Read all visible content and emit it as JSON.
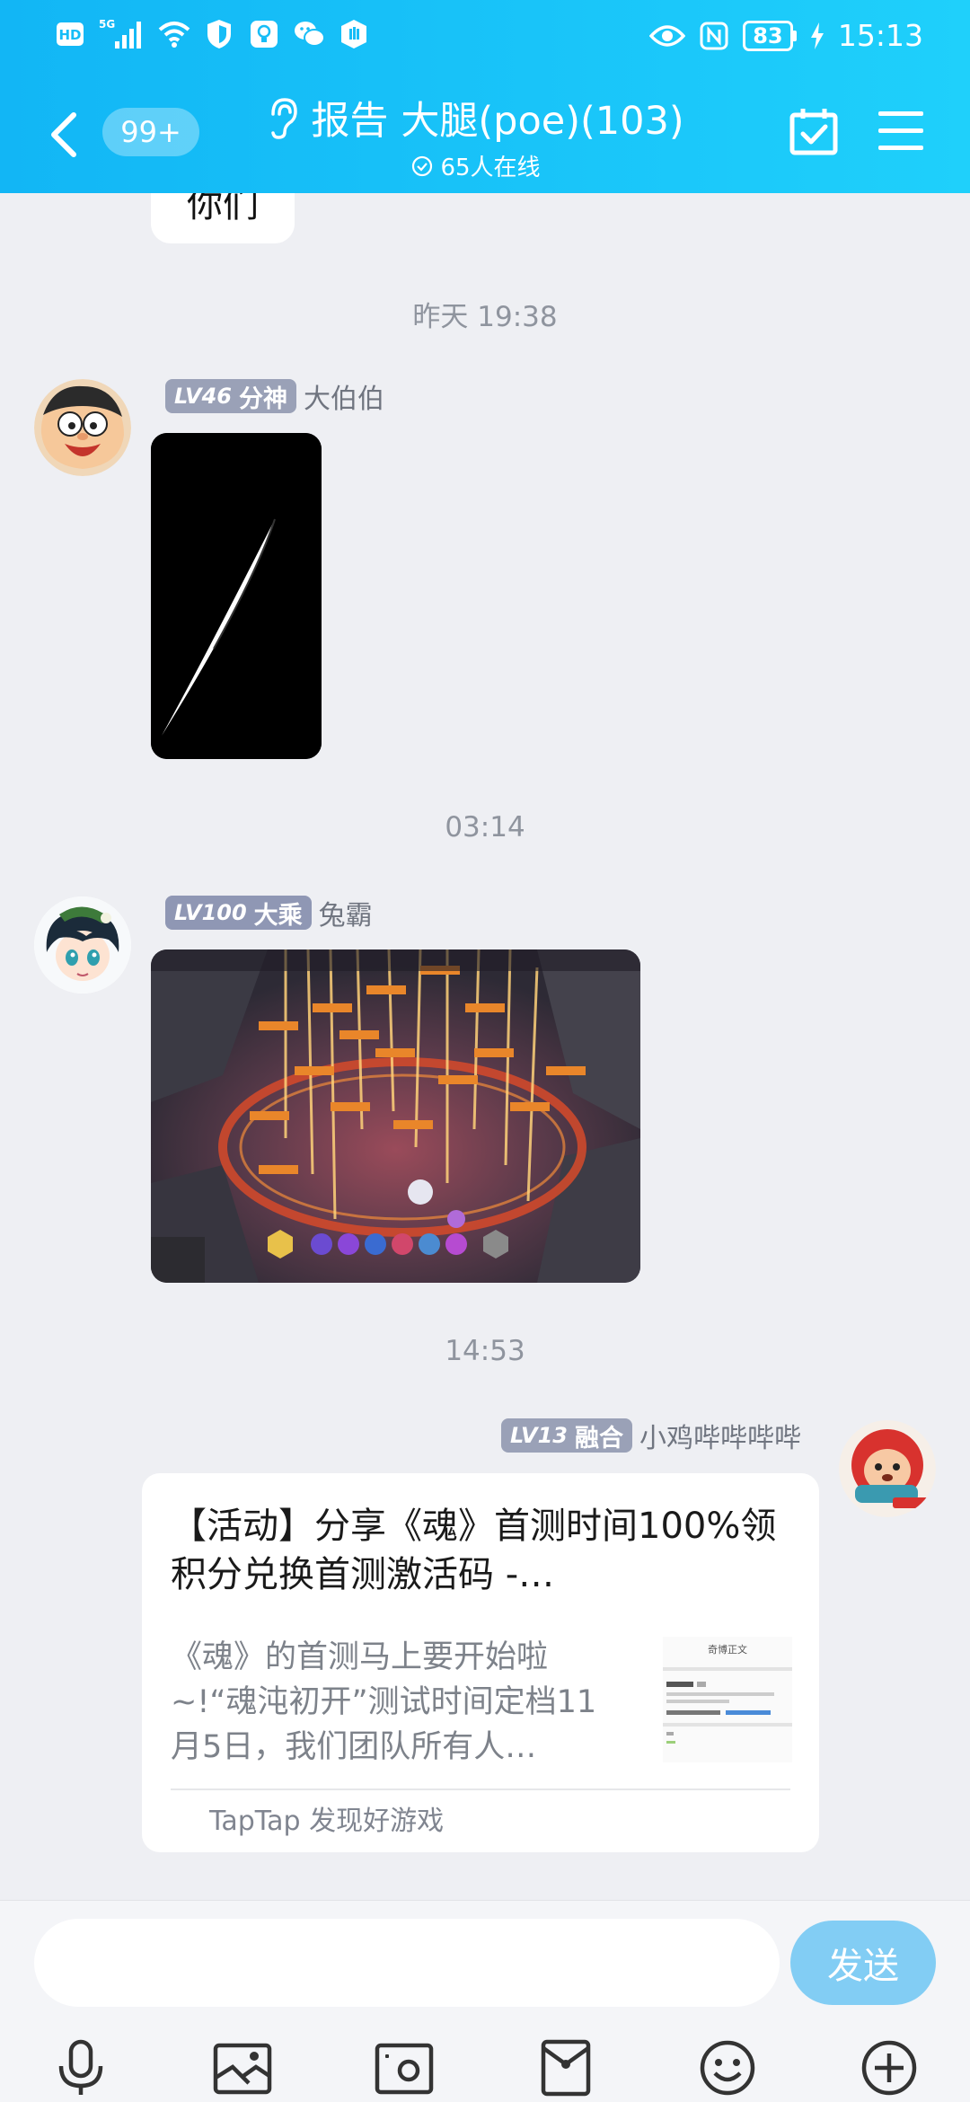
{
  "status_bar": {
    "hd": "HD",
    "network": "5G",
    "battery": "83",
    "time": "15:13"
  },
  "header": {
    "unread_badge": "99+",
    "title_tag": "报告",
    "title_name": "大腿(poe)(103)",
    "online": "65人在线"
  },
  "partial_message": {
    "text": "你们"
  },
  "messages": [
    {
      "timestamp": "昨天 19:38",
      "level": "LV46",
      "rank": "分神",
      "rank_color": "#9aa1b7",
      "nickname": "大伯伯",
      "content": "image"
    },
    {
      "timestamp": "03:14",
      "level": "LV100",
      "rank": "大乘",
      "rank_color": "#8f97b4",
      "nickname": "兔霸",
      "content": "game-screenshot"
    },
    {
      "timestamp": "14:53",
      "level": "LV13",
      "rank": "融合",
      "rank_color": "#9aa1b7",
      "nickname": "小鸡哔哔哔哔",
      "card": {
        "title": "【活动】分享《魂》首测时间100%领积分兑换首测激活码 -…",
        "description": "《魂》的首测马上要开始啦~!“魂沌初开”测试时间定档11月5日，我们团队所有人…",
        "thumb_title": "奇博正文",
        "source": "TapTap 发现好游戏"
      }
    }
  ],
  "input": {
    "placeholder": "",
    "send_label": "发送"
  },
  "toolbar": {
    "icons": [
      "microphone-icon",
      "image-icon",
      "camera-icon",
      "red-packet-icon",
      "emoji-icon",
      "plus-icon"
    ]
  },
  "colors": {
    "header_start": "#12b6f5",
    "header_end": "#1fd0fb",
    "send_button": "#82cdf4",
    "chat_background": "#eeeff3"
  }
}
